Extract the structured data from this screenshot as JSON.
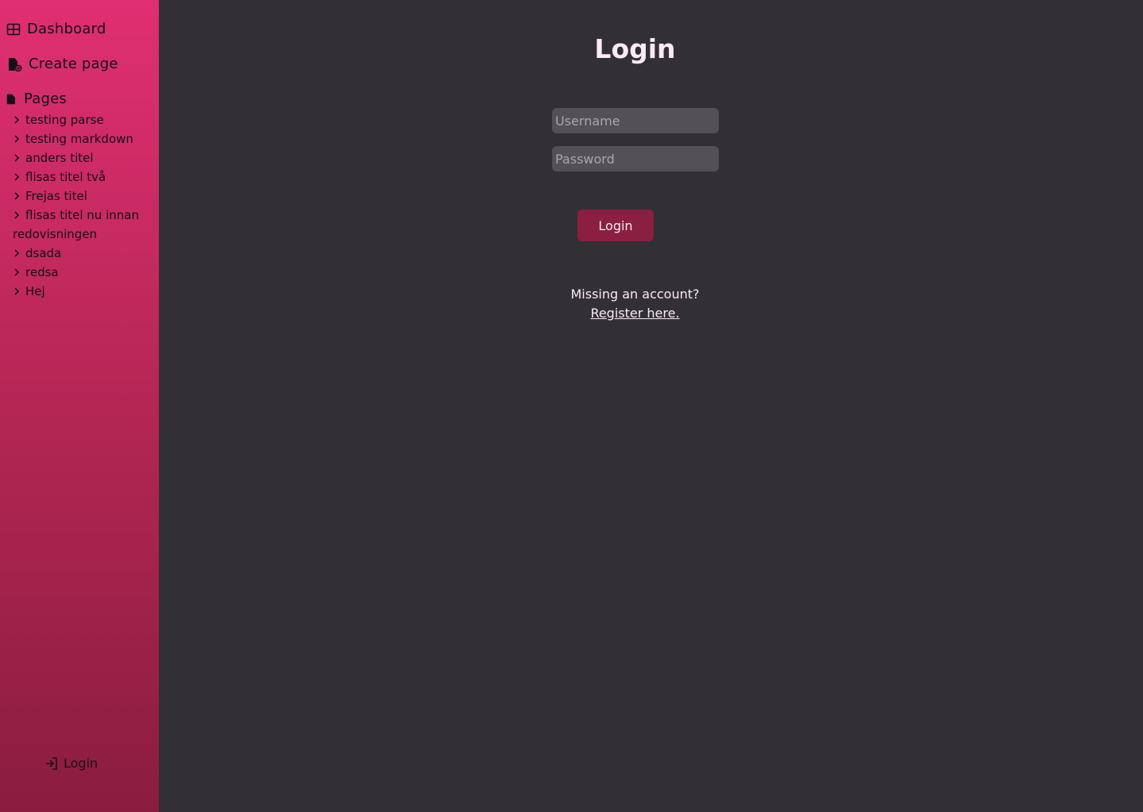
{
  "sidebar": {
    "dashboard_label": "Dashboard",
    "create_label": "Create page",
    "pages_label": "Pages",
    "pages": [
      "testing parse",
      "testing markdown",
      "anders titel",
      "flisas titel två",
      "Frejas titel",
      "flisas titel nu innan redovisningen",
      "dsada",
      "redsa",
      "Hej"
    ],
    "login_label": "Login",
    "gradient": [
      "#e02f72",
      "#8a1d3f"
    ]
  },
  "main": {
    "title": "Login",
    "username_placeholder": "Username",
    "password_placeholder": "Password",
    "login_button": "Login",
    "missing_text": "Missing an account?",
    "register_link": "Register here.",
    "background": "#323034",
    "accent": "#8a1f41"
  }
}
